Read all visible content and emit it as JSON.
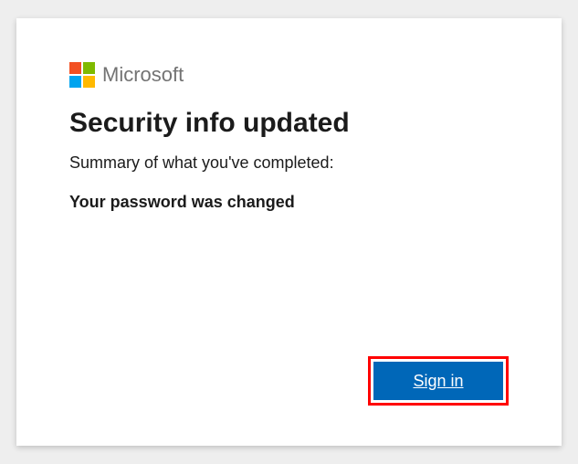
{
  "brand": {
    "name": "Microsoft"
  },
  "page": {
    "heading": "Security info updated",
    "subheading": "Summary of what you've completed:",
    "status": "Your password was changed"
  },
  "actions": {
    "signin_label": "Sign in"
  },
  "colors": {
    "primary_button": "#0067b8",
    "highlight_border": "#ff0000"
  }
}
